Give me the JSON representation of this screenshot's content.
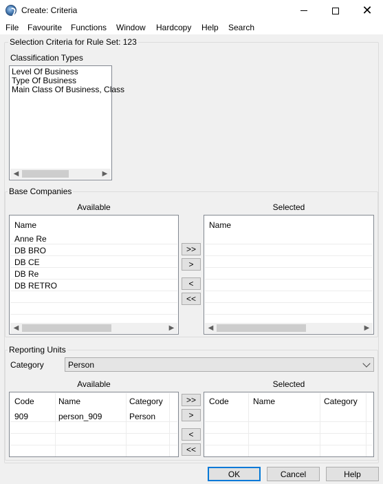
{
  "window": {
    "title": "Create:  Criteria",
    "controls": {
      "minimize": "minimize",
      "maximize": "maximize",
      "close": "close"
    }
  },
  "menu": [
    "File",
    "Favourite",
    "Functions",
    "Window",
    "Hardcopy",
    "Help",
    "Search"
  ],
  "selection_label": "Selection Criteria for Rule Set: 123",
  "classification": {
    "group_label": "Classification Types",
    "items": [
      "Level Of Business",
      "Type Of Business",
      "Main Class Of Business, Class"
    ]
  },
  "base_companies": {
    "group_label": "Base Companies",
    "available_label": "Available",
    "selected_label": "Selected",
    "column_name": "Name",
    "available_items": [
      "Anne Re",
      "DB BRO",
      "DB CE",
      "DB Re",
      "DB RETRO"
    ],
    "buttons": {
      "add_all": ">>",
      "add": ">",
      "remove": "<",
      "remove_all": "<<"
    }
  },
  "reporting_units": {
    "group_label": "Reporting Units",
    "category_label": "Category",
    "category_value": "Person",
    "available_label": "Available",
    "selected_label": "Selected",
    "columns": {
      "code": "Code",
      "name": "Name",
      "category": "Category"
    },
    "available_rows": [
      {
        "code": "909",
        "name": "person_909",
        "category": "Person"
      }
    ],
    "buttons": {
      "add_all": ">>",
      "add": ">",
      "remove": "<",
      "remove_all": "<<"
    }
  },
  "footer": {
    "ok": "OK",
    "cancel": "Cancel",
    "help": "Help"
  },
  "icons": {
    "scroll_left": "◀",
    "scroll_right": "▶",
    "close": "✕"
  }
}
